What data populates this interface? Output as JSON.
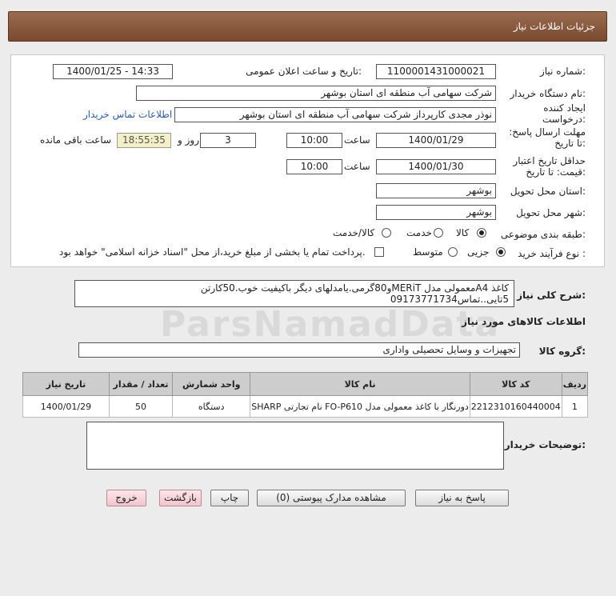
{
  "header": {
    "title": "جزئیات اطلاعات نیاز"
  },
  "form": {
    "need_number_label": "شماره نیاز:",
    "need_number": "1100001431000021",
    "announce_label": "تاریخ و ساعت اعلان عمومی:",
    "announce_value": "1400/01/25 - 14:33",
    "buyer_org_label": "نام دستگاه خریدار:",
    "buyer_org": "شرکت سهامی آب منطقه ای استان بوشهر",
    "creator_label": "ایجاد کننده درخواست:",
    "creator": "نوذر مجدی کارپرداز شرکت سهامی آب منطقه ای استان بوشهر",
    "contact_link": "اطلاعات تماس خریدار",
    "deadline_label": "مهلت ارسال پاسخ: تا تاریخ:",
    "deadline_date": "1400/01/29",
    "time_label": "ساعت",
    "deadline_time": "10:00",
    "days_value": "3",
    "days_label": "روز و",
    "remaining_time": "18:55:35",
    "remaining_label": "ساعت باقی مانده",
    "validity_label": "حداقل تاریخ اعتبار قیمت: تا تاریخ:",
    "validity_date": "1400/01/30",
    "validity_time": "10:00",
    "province_label": "استان محل تحویل:",
    "province": "بوشهر",
    "city_label": "شهر محل تحویل:",
    "city": "بوشهر",
    "category_label": "طبقه بندی موضوعی:",
    "category_options": [
      "کالا",
      "خدمت",
      "کالا/خدمت"
    ],
    "process_label": "نوع فرآیند خرید :",
    "process_options": [
      "جزیی",
      "متوسط"
    ],
    "payment_note": "پرداخت تمام یا بخشی از مبلغ خرید،از محل \"اسناد خزانه اسلامی\" خواهد بود."
  },
  "description": {
    "label": "شرح کلی نیاز:",
    "text": "کاغذ A4معمولی مدل MERiTو80گرمی.یامدلهای دیگر باکیفیت خوب.50کارتن 5تایی..تماس09173771734"
  },
  "goods_info_title": "اطلاعات کالاهای مورد نیاز",
  "goods_group": {
    "label": "گروه کالا:",
    "value": "تجهیزات و وسایل تحصیلی واداری"
  },
  "table": {
    "headers": [
      "ردیف",
      "کد کالا",
      "نام کالا",
      "واحد شمارش",
      "تعداد / مقدار",
      "تاریخ نیاز"
    ],
    "rows": [
      [
        "1",
        "2212310160440004",
        "دورنگار با کاغذ معمولی مدل FO-P610 نام تجارتی SHARP",
        "دستگاه",
        "50",
        "1400/01/29"
      ]
    ]
  },
  "buyer_notes_label": "توضیحات خریدار:",
  "buttons": {
    "reply": "پاسخ به نیاز",
    "attachments": "مشاهده مدارک پیوستی (0)",
    "print": "چاپ",
    "back": "بازگشت",
    "exit": "خروج"
  },
  "watermark": "ParsNamadData"
}
